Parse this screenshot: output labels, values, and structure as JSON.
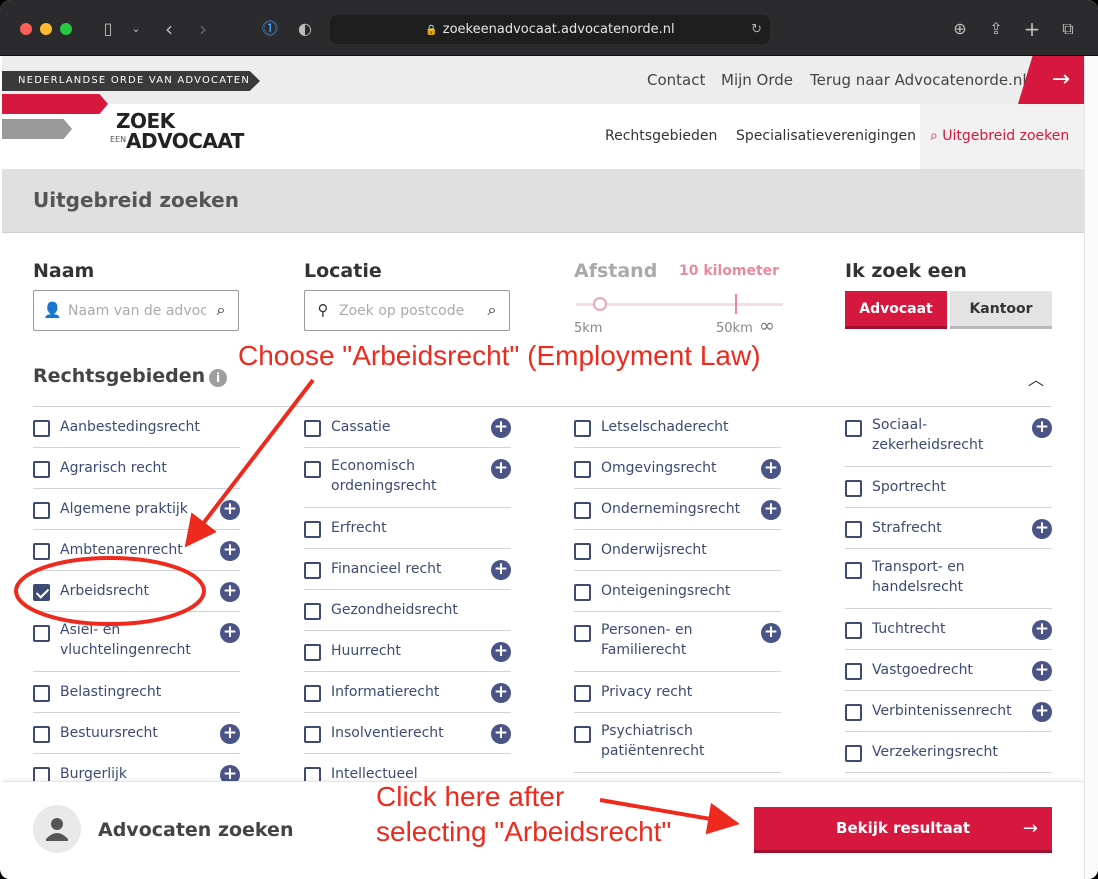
{
  "browser": {
    "url": "zoekeenadvocaat.advocatenorde.nl",
    "traffic_colors": [
      "#fe5f57",
      "#febc2e",
      "#28c840"
    ]
  },
  "header": {
    "ribbon_text": "NEDERLANDSE ORDE VAN ADVOCATEN",
    "top_links": [
      "Contact",
      "Mijn Orde",
      "Terug naar Advocatenorde.nl"
    ],
    "logo": {
      "line1": "ZOEK",
      "small": "EEN",
      "line2": "ADVOCAAT"
    },
    "nav": [
      "Rechtsgebieden",
      "Specialisatieverenigingen"
    ],
    "search_link": "Uitgebreid zoeken"
  },
  "page": {
    "title": "Uitgebreid zoeken"
  },
  "filters": {
    "naam": {
      "label": "Naam",
      "placeholder": "Naam van de advocaat"
    },
    "locatie": {
      "label": "Locatie",
      "placeholder": "Zoek op postcode"
    },
    "afstand": {
      "label": "Afstand",
      "value": "10 kilometer",
      "min_label": "5km",
      "max_label": "50km",
      "infinity_label": "∞"
    },
    "zoek_een": {
      "label": "Ik zoek een",
      "options": [
        "Advocaat",
        "Kantoor"
      ],
      "selected": "Advocaat"
    }
  },
  "rechtsgebieden": {
    "title": "Rechtsgebieden",
    "columns": [
      [
        {
          "label": "Aanbestedingsrecht",
          "checked": false,
          "plus": false
        },
        {
          "label": "Agrarisch recht",
          "checked": false,
          "plus": false
        },
        {
          "label": "Algemene praktijk",
          "checked": false,
          "plus": true
        },
        {
          "label": "Ambtenarenrecht",
          "checked": false,
          "plus": true
        },
        {
          "label": "Arbeidsrecht",
          "checked": true,
          "plus": true
        },
        {
          "label": "Asiel- en vluchtelingenrecht",
          "checked": false,
          "plus": true
        },
        {
          "label": "Belastingrecht",
          "checked": false,
          "plus": false
        },
        {
          "label": "Bestuursrecht",
          "checked": false,
          "plus": true
        },
        {
          "label": "Burgerlijk",
          "checked": false,
          "plus": true
        }
      ],
      [
        {
          "label": "Cassatie",
          "checked": false,
          "plus": true
        },
        {
          "label": "Economisch ordeningsrecht",
          "checked": false,
          "plus": true
        },
        {
          "label": "Erfrecht",
          "checked": false,
          "plus": false
        },
        {
          "label": "Financieel recht",
          "checked": false,
          "plus": true
        },
        {
          "label": "Gezondheidsrecht",
          "checked": false,
          "plus": false
        },
        {
          "label": "Huurrecht",
          "checked": false,
          "plus": true
        },
        {
          "label": "Informatierecht",
          "checked": false,
          "plus": true
        },
        {
          "label": "Insolventierecht",
          "checked": false,
          "plus": true
        },
        {
          "label": "Intellectueel",
          "checked": false,
          "plus": false
        }
      ],
      [
        {
          "label": "Letselschaderecht",
          "checked": false,
          "plus": false
        },
        {
          "label": "Omgevingsrecht",
          "checked": false,
          "plus": true
        },
        {
          "label": "Ondernemingsrecht",
          "checked": false,
          "plus": true
        },
        {
          "label": "Onderwijsrecht",
          "checked": false,
          "plus": false
        },
        {
          "label": "Onteigeningsrecht",
          "checked": false,
          "plus": false
        },
        {
          "label": "Personen- en Familierecht",
          "checked": false,
          "plus": true
        },
        {
          "label": "Privacy recht",
          "checked": false,
          "plus": false
        },
        {
          "label": "Psychiatrisch patiëntenrecht",
          "checked": false,
          "plus": false
        }
      ],
      [
        {
          "label": "Sociaal-zekerheidsrecht",
          "checked": false,
          "plus": true
        },
        {
          "label": "Sportrecht",
          "checked": false,
          "plus": false
        },
        {
          "label": "Strafrecht",
          "checked": false,
          "plus": true
        },
        {
          "label": "Transport- en handelsrecht",
          "checked": false,
          "plus": false
        },
        {
          "label": "Tuchtrecht",
          "checked": false,
          "plus": true
        },
        {
          "label": "Vastgoedrecht",
          "checked": false,
          "plus": true
        },
        {
          "label": "Verbintenissenrecht",
          "checked": false,
          "plus": true
        },
        {
          "label": "Verzekeringsrecht",
          "checked": false,
          "plus": false
        }
      ]
    ]
  },
  "footer": {
    "title": "Advocaten zoeken",
    "button": "Bekijk resultaat"
  },
  "annotations": {
    "choose": "Choose \"Arbeidsrecht\" (Employment Law)",
    "click_line1": "Click here after",
    "click_line2": "selecting \"Arbeidsrecht\"",
    "color": "#ee2a1e"
  }
}
